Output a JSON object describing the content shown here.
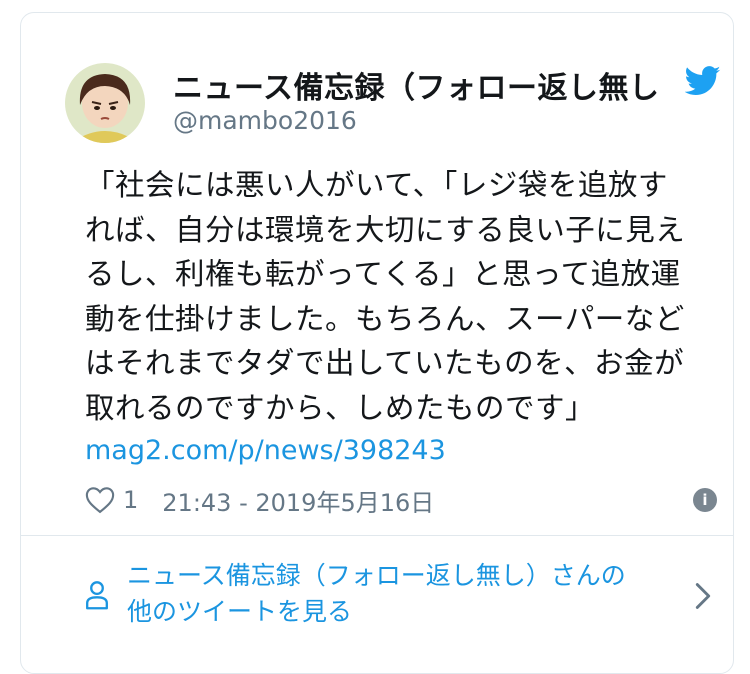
{
  "account": {
    "name": "ニュース備忘録（フォロー返し無し",
    "handle": "@mambo2016"
  },
  "tweet": {
    "lines": [
      "「社会には悪い人がいて、「レジ袋を追放す",
      "れば、自分は環境を大切にする良い子に見え",
      "るし、利権も転がってくる」と思って追放運",
      "動を仕掛けました。もちろん、スーパーなど",
      "はそれまでタダで出していたものを、お金が",
      "取れるのですから、しめたものです」"
    ],
    "link": "mag2.com/p/news/398243",
    "likes": "1",
    "timestamp": "21:43 - 2019年5月16日"
  },
  "footer": {
    "line1": "ニュース備忘録（フォロー返し無し）さんの",
    "line2": "他のツイートを見る"
  },
  "colors": {
    "accent": "#1b95e0",
    "twitter_bird": "#1da1f2",
    "muted": "#657786",
    "border": "#e1e8ed"
  },
  "icons": {
    "avatar": "avatar-illustration",
    "brand": "twitter-bird-icon",
    "like": "heart-outline-icon",
    "info": "info-icon",
    "profile": "person-outline-icon",
    "more": "chevron-right-icon"
  }
}
